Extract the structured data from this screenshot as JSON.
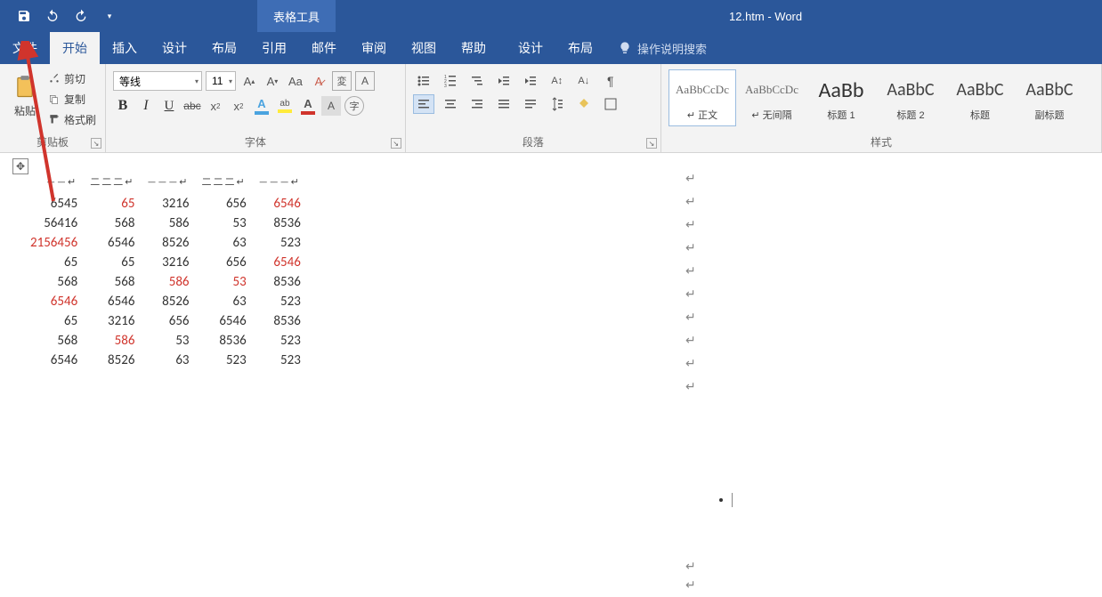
{
  "titlebar": {
    "context_tab": "表格工具",
    "doc_title": "12.htm - Word"
  },
  "tabs": {
    "file": "文件",
    "home": "开始",
    "insert": "插入",
    "design": "设计",
    "layout": "布局",
    "references": "引用",
    "mailings": "邮件",
    "review": "审阅",
    "view": "视图",
    "help": "帮助",
    "table_design": "设计",
    "table_layout": "布局",
    "tell_me": "操作说明搜索"
  },
  "ribbon": {
    "clipboard": {
      "paste": "粘贴",
      "cut": "剪切",
      "copy": "复制",
      "format_painter": "格式刷",
      "group_label": "剪贴板"
    },
    "font": {
      "font_name": "等线",
      "font_size": "11",
      "group_label": "字体"
    },
    "paragraph": {
      "group_label": "段落"
    },
    "styles": {
      "group_label": "样式",
      "preview_text_small": "AaBbCcDc",
      "preview_text_big": "AaBb",
      "preview_text_h": "AaBbC",
      "items": [
        {
          "name": "↵ 正文"
        },
        {
          "name": "↵ 无间隔"
        },
        {
          "name": "标题 1"
        },
        {
          "name": "标题 2"
        },
        {
          "name": "标题"
        },
        {
          "name": "副标题"
        }
      ]
    }
  },
  "table": {
    "header": [
      "——↵",
      "二二二↵",
      "———↵",
      "二二二↵",
      "———↵"
    ],
    "rows": [
      [
        {
          "v": "6545"
        },
        {
          "v": "65",
          "red": true
        },
        {
          "v": "3216"
        },
        {
          "v": "656"
        },
        {
          "v": "6546",
          "red": true
        }
      ],
      [
        {
          "v": "56416"
        },
        {
          "v": "568"
        },
        {
          "v": "586"
        },
        {
          "v": "53"
        },
        {
          "v": "8536"
        }
      ],
      [
        {
          "v": "2156456",
          "red": true
        },
        {
          "v": "6546"
        },
        {
          "v": "8526"
        },
        {
          "v": "63"
        },
        {
          "v": "523"
        }
      ],
      [
        {
          "v": "65"
        },
        {
          "v": "65"
        },
        {
          "v": "3216"
        },
        {
          "v": "656"
        },
        {
          "v": "6546",
          "red": true
        }
      ],
      [
        {
          "v": "568"
        },
        {
          "v": "568"
        },
        {
          "v": "586",
          "red": true
        },
        {
          "v": "53",
          "red": true
        },
        {
          "v": "8536"
        }
      ],
      [
        {
          "v": "6546",
          "red": true
        },
        {
          "v": "6546"
        },
        {
          "v": "8526"
        },
        {
          "v": "63"
        },
        {
          "v": "523"
        }
      ],
      [
        {
          "v": "65"
        },
        {
          "v": "3216"
        },
        {
          "v": "656"
        },
        {
          "v": "6546"
        },
        {
          "v": "8536"
        }
      ],
      [
        {
          "v": "568"
        },
        {
          "v": "586",
          "red": true
        },
        {
          "v": "53"
        },
        {
          "v": "8536"
        },
        {
          "v": "523"
        }
      ],
      [
        {
          "v": "6546"
        },
        {
          "v": "8526"
        },
        {
          "v": "63"
        },
        {
          "v": "523"
        },
        {
          "v": "523"
        }
      ]
    ]
  }
}
